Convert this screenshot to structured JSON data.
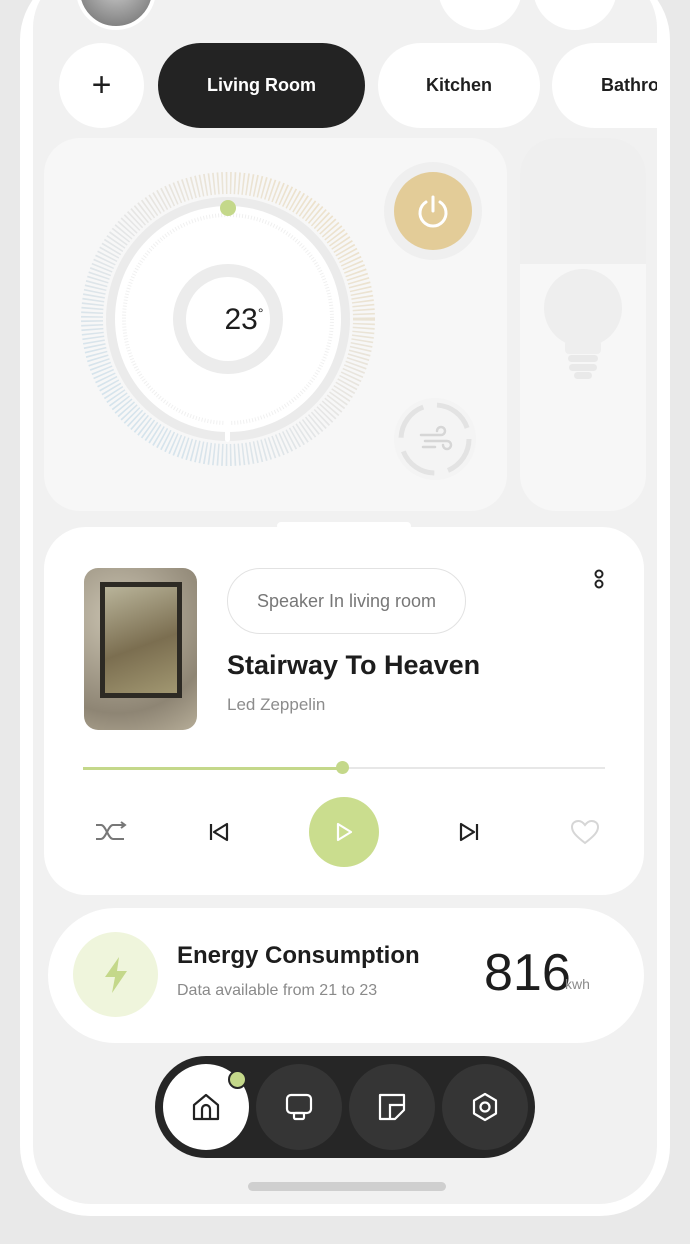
{
  "rooms": {
    "add_label": "+",
    "items": [
      {
        "label": "Living Room",
        "active": true
      },
      {
        "label": "Kitchen",
        "active": false
      },
      {
        "label": "Bathro",
        "active": false
      }
    ]
  },
  "thermostat": {
    "temperature": "23",
    "unit": "°",
    "power_color": "#e3cc98"
  },
  "music": {
    "speaker_label": "Speaker In living room",
    "song_title": "Stairway To Heaven",
    "artist": "Led Zeppelin",
    "progress": 0.5,
    "accent": "#cadd8e"
  },
  "energy": {
    "title": "Energy Consumption",
    "subtitle": "Data available from 21 to 23",
    "value": "816",
    "unit": "kwh"
  },
  "nav": {
    "items": [
      "home-icon",
      "device-icon",
      "rooms-icon",
      "settings-icon"
    ],
    "active": "home-icon"
  }
}
